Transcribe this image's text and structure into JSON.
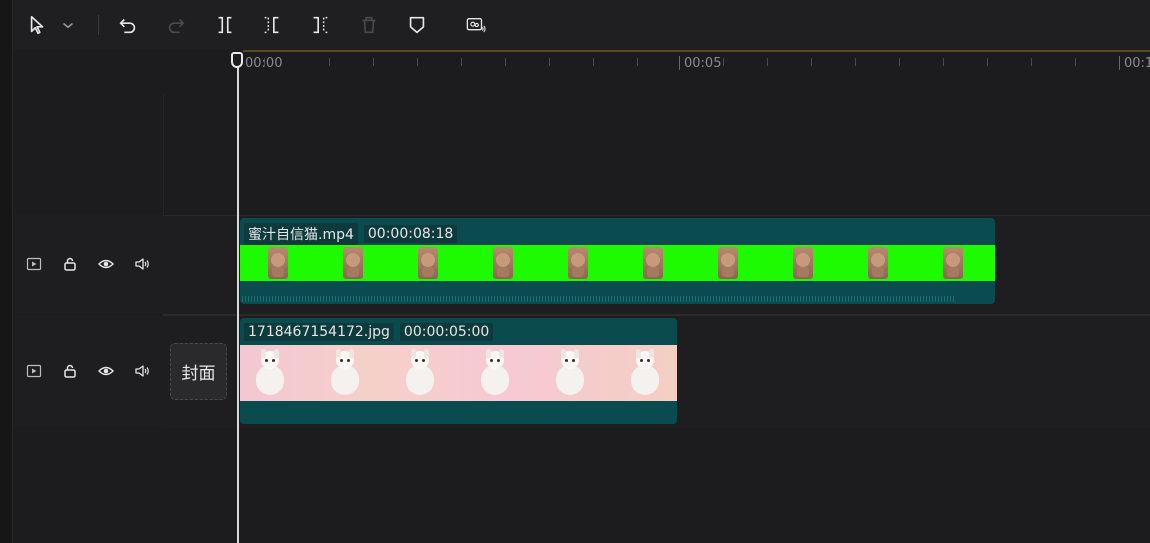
{
  "toolbar": {
    "icons": [
      "select-arrow-icon",
      "chevron-down-icon",
      "undo-icon",
      "redo-icon",
      "split-icon",
      "trim-left-icon",
      "trim-right-icon",
      "delete-icon",
      "marker-icon",
      "screen-record-icon"
    ]
  },
  "ruler": {
    "labels": [
      "00:00",
      "00:05",
      "00:1"
    ]
  },
  "tracks": [
    {
      "clip_name": "蜜汁自信猫.mp4",
      "duration": "00:00:08:18"
    },
    {
      "clip_name": "1718467154172.jpg",
      "duration": "00:00:05:00"
    }
  ],
  "cover_label": "封面",
  "colors": {
    "clip_bg": "#094b4f",
    "green_screen": "#1efb00",
    "background": "#1c1c1e"
  }
}
